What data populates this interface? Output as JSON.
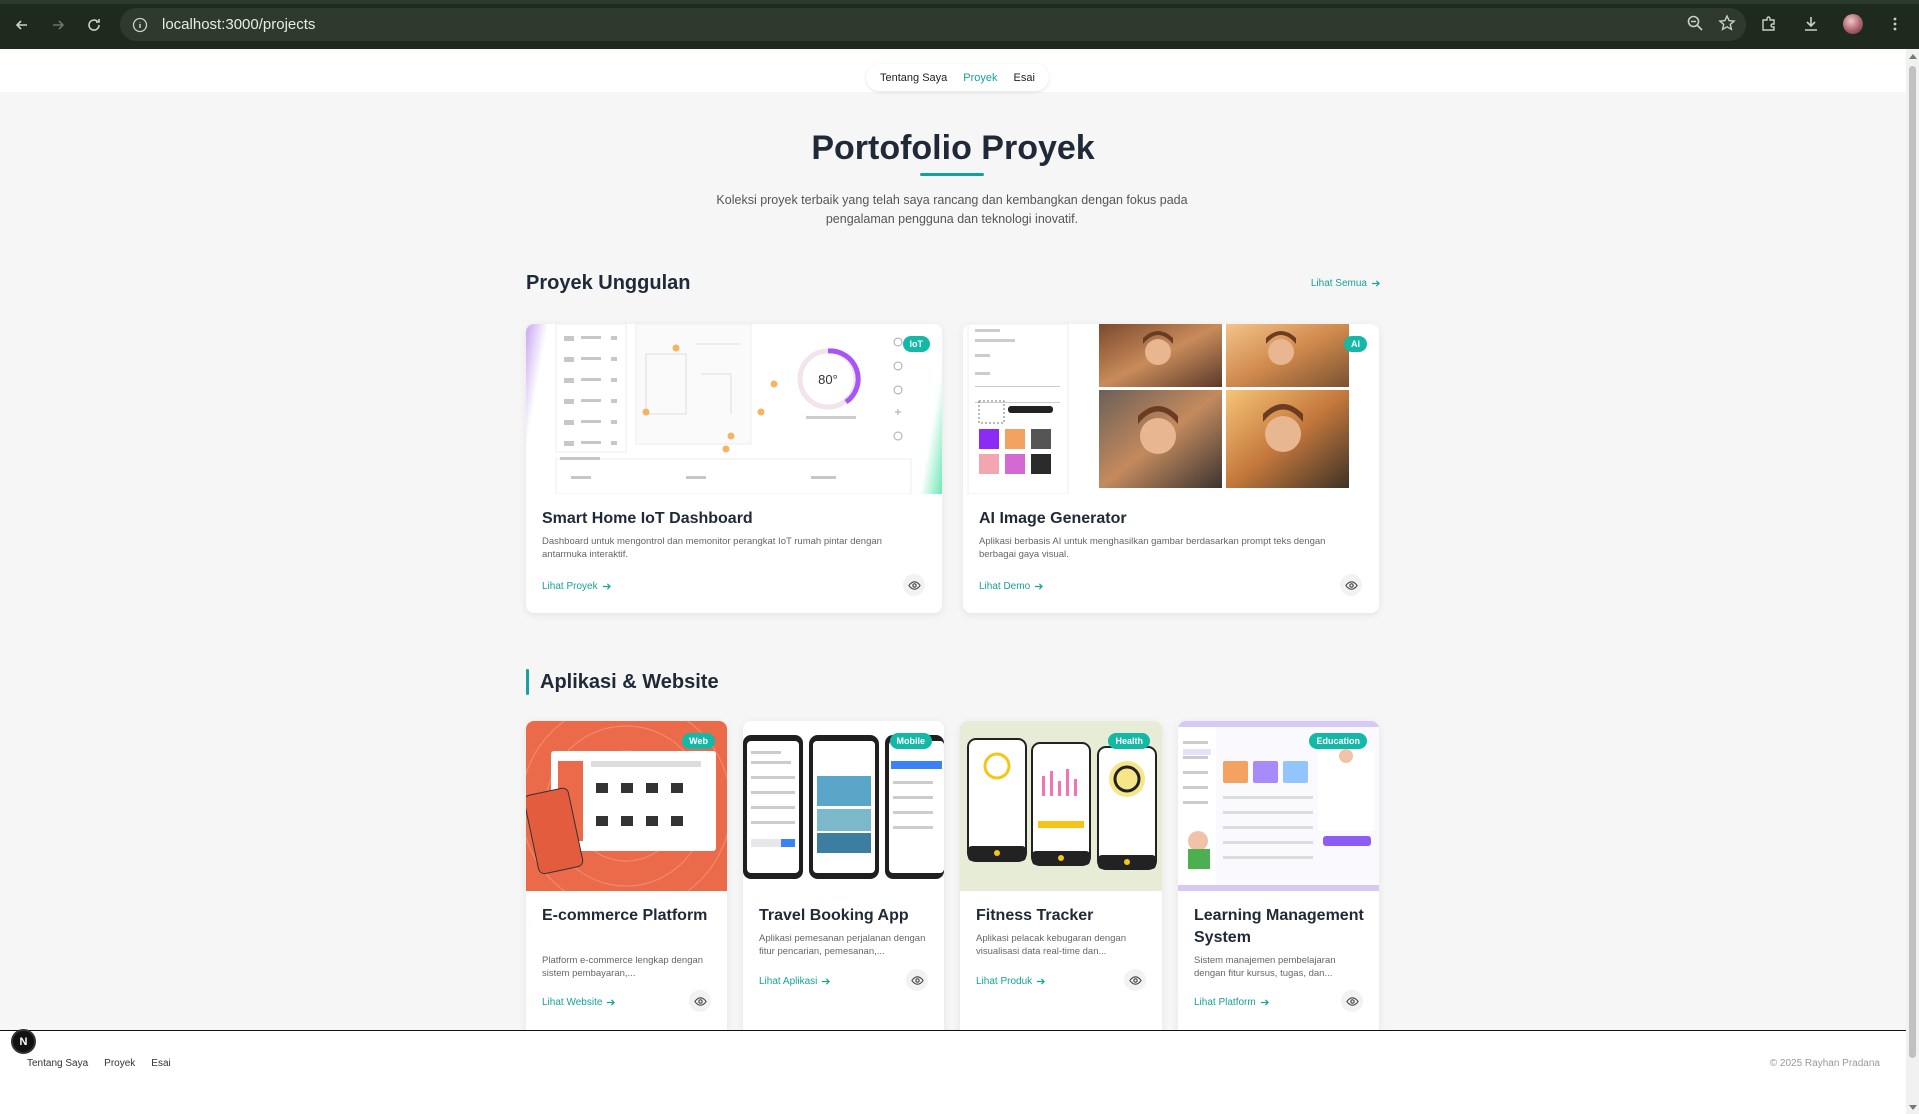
{
  "browser": {
    "url": "localhost:3000/projects"
  },
  "nav": {
    "items": [
      {
        "label": "Tentang Saya",
        "active": false
      },
      {
        "label": "Proyek",
        "active": true
      },
      {
        "label": "Esai",
        "active": false
      }
    ]
  },
  "hero": {
    "title": "Portofolio Proyek",
    "subtitle": "Koleksi proyek terbaik yang telah saya rancang dan kembangkan dengan fokus pada pengalaman pengguna dan teknologi inovatif."
  },
  "featured": {
    "heading": "Proyek Unggulan",
    "see_all": "Lihat Semua",
    "cards": [
      {
        "title": "Smart Home IoT Dashboard",
        "description": "Dashboard untuk mengontrol dan memonitor perangkat IoT rumah pintar dengan antarmuka interaktif.",
        "link": "Lihat Proyek",
        "badge": "IoT",
        "thermostat": "80°"
      },
      {
        "title": "AI Image Generator",
        "description": "Aplikasi berbasis AI untuk menghasilkan gambar berdasarkan prompt teks dengan berbagai gaya visual.",
        "link": "Lihat Demo",
        "badge": "AI"
      }
    ]
  },
  "apps": {
    "heading": "Aplikasi & Website",
    "cards": [
      {
        "title": "E-commerce Platform",
        "description": "Platform e-commerce lengkap dengan sistem pembayaran,...",
        "link": "Lihat Website",
        "badge": "Web"
      },
      {
        "title": "Travel Booking App",
        "description": "Aplikasi pemesanan perjalanan dengan fitur pencarian, pemesanan,...",
        "link": "Lihat Aplikasi",
        "badge": "Mobile"
      },
      {
        "title": "Fitness Tracker",
        "description": "Aplikasi pelacak kebugaran dengan visualisasi data real-time dan...",
        "link": "Lihat Produk",
        "badge": "Health"
      },
      {
        "title": "Learning Management System",
        "description": "Sistem manajemen pembelajaran dengan fitur kursus, tugas, dan...",
        "link": "Lihat Platform",
        "badge": "Education"
      }
    ]
  },
  "footer": {
    "links": [
      "Tentang Saya",
      "Proyek",
      "Esai"
    ],
    "copyright": "© 2025 Rayhan Pradana"
  },
  "dev_badge": "N",
  "colors": {
    "accent": "#14a39a",
    "badge": "#14b8a6"
  }
}
